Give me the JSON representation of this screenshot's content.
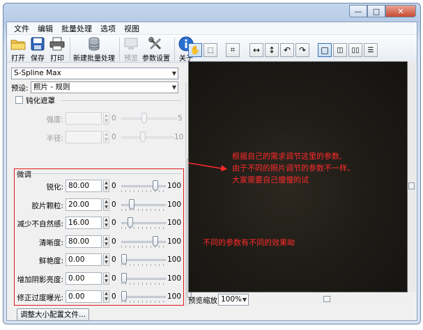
{
  "window": {
    "controls": {
      "minimize": "—",
      "maximize": "□",
      "close": "✕"
    }
  },
  "menu": [
    "文件",
    "编辑",
    "批量处理",
    "选项",
    "视图"
  ],
  "toolbar": {
    "open": "打开",
    "save": "保存",
    "print": "打印",
    "new_batch": "新建批量处理",
    "preview": "预览",
    "settings": "参数设置",
    "about": "关于"
  },
  "algorithm": {
    "selected": "S-Spline Max"
  },
  "preset": {
    "label": "预设:",
    "selected": "照片 - 规则"
  },
  "blur_mask": {
    "checkbox_label": "钝化遮罩",
    "strength": {
      "label": "强度:",
      "value": "",
      "min": "0",
      "max": "5",
      "level": 0.4
    },
    "radius": {
      "label": "半径:",
      "value": "",
      "min": "0",
      "max": "10",
      "level": 0.4
    }
  },
  "fine_tune": {
    "heading": "微调",
    "rows": [
      {
        "label": "锐化:",
        "value": "80.00",
        "min": "0",
        "max": "100",
        "level": 0.8
      },
      {
        "label": "胶片颗粒:",
        "value": "20.00",
        "min": "0",
        "max": "100",
        "level": 0.2
      },
      {
        "label": "减少不自然感:",
        "value": "16.00",
        "min": "0",
        "max": "100",
        "level": 0.16
      },
      {
        "label": "清晰度:",
        "value": "80.00",
        "min": "0",
        "max": "100",
        "level": 0.8
      },
      {
        "label": "鲜艳度:",
        "value": "0.00",
        "min": "0",
        "max": "100",
        "level": 0.0
      },
      {
        "label": "增加阴影亮度:",
        "value": "0.00",
        "min": "0",
        "max": "100",
        "level": 0.0
      },
      {
        "label": "修正过度曝光:",
        "value": "0.00",
        "min": "0",
        "max": "100",
        "level": 0.0
      }
    ]
  },
  "resize_config_button": "调整大小配置文件...",
  "zoom": {
    "label": "预览缩放:",
    "value": "100%"
  },
  "annotations": {
    "note1_line1": "根据自己的需求调节这里的参数,",
    "note1_line2": "由于不同的照片调节的参数不一样、",
    "note1_line3": "大家需要自己慢慢的试",
    "note2": "不同的参数有不同的效果呦"
  },
  "colors": {
    "annotation": "#ff2a2a",
    "preview_bg": "#1f1c17"
  }
}
